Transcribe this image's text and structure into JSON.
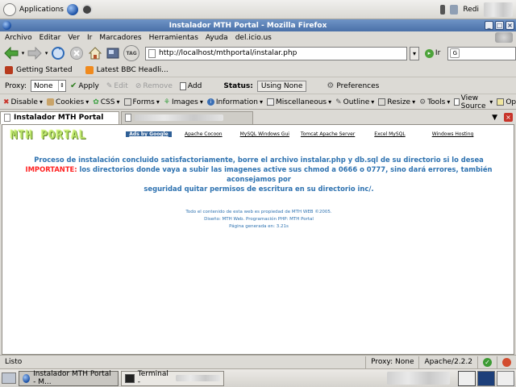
{
  "top_panel": {
    "applications_label": "Applications",
    "user_label": "Redi"
  },
  "window": {
    "title": "Instalador MTH Portal - Mozilla Firefox"
  },
  "menu": [
    "Archivo",
    "Editar",
    "Ver",
    "Ir",
    "Marcadores",
    "Herramientas",
    "Ayuda",
    "del.icio.us"
  ],
  "navbar": {
    "tag_label": "TAG",
    "url": "http://localhost/mthportal/instalar.php",
    "go_label": "Ir"
  },
  "bookmarks": [
    "Getting Started",
    "Latest BBC Headli..."
  ],
  "proxybar": {
    "proxy_label": "Proxy:",
    "proxy_value": "None",
    "apply_label": "Apply",
    "edit_label": "Edit",
    "remove_label": "Remove",
    "add_label": "Add",
    "status_label": "Status:",
    "status_value": "Using None",
    "preferences_label": "Preferences"
  },
  "devbar": [
    "Disable",
    "Cookies",
    "CSS",
    "Forms",
    "Images",
    "Information",
    "Miscellaneous",
    "Outline",
    "Resize",
    "Tools",
    "View Source",
    "Options"
  ],
  "tabs": {
    "active": "Instalador MTH Portal"
  },
  "page": {
    "logo": "MTH PORTAL",
    "links": [
      "Ads by Google",
      "Apache Cocoon",
      "MySQL Windows Gui",
      "Tomcat Apache Server",
      "Excel MySQL",
      "Windows Hosting"
    ],
    "success": "Proceso de instalación concluido satisfactoriamente, borre el archivo instalar.php y db.sql de su directorio si lo desea",
    "important_label": "IMPORTANTE:",
    "important_text": " los directorios donde vaya a subir las imagenes active sus chmod a 0666 o 0777, sino dará errores, también aconsejamos por",
    "important_text_2": "seguridad quitar permisos de escritura en su directorio inc/.",
    "footer_1": "Todo el contenido de esta web es propiedad de MTH WEB ©2005.",
    "footer_2": "Diseño: MTH Web. Programación PHP: MTH Portal",
    "footer_3": "Página generada en: 3.21s"
  },
  "statusbar": {
    "status": "Listo",
    "proxy": "Proxy: None",
    "server": "Apache/2.2.2"
  },
  "taskbar": {
    "firefox_task": "Instalador MTH Portal - M...",
    "terminal_task": "Terminal - "
  },
  "colors": {
    "accent_blue": "#2e72b0",
    "important_red": "#ff2323",
    "logo_green": "#b9e36a"
  }
}
